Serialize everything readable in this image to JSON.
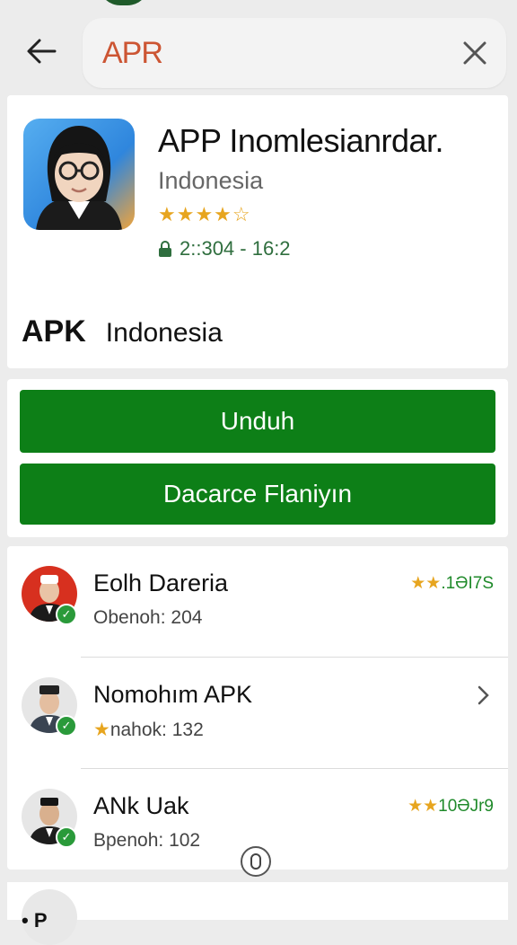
{
  "search": {
    "query": "APR",
    "back_icon": "arrow-left-icon",
    "clear_icon": "close-icon"
  },
  "app": {
    "title": "APP Inomlesianrdar.",
    "subtitle": "Indonesia",
    "rating_stars": "★★★★☆",
    "rating_value": 4.5,
    "meta": "2::304 - 16:2",
    "meta_icon": "lock-icon"
  },
  "brand": {
    "name_part1": "APK",
    "name_part2": "",
    "country": "Indonesia"
  },
  "actions": {
    "primary_label": "Unduh",
    "secondary_label": "Dacarce Flaniyın",
    "button_color": "#0d7f17"
  },
  "list": {
    "items": [
      {
        "name": "Eolh Dareria",
        "sub": "Obenoh: 204",
        "rating_stars": "★★",
        "rating_text": ".1ƏI7S",
        "has_chevron": false
      },
      {
        "name": "Nomohım APK",
        "sub_star": "★",
        "sub": "nahok: 132",
        "has_chevron": true
      },
      {
        "name": "ANk Uak",
        "sub": "Bpenoh: 102",
        "rating_stars": "★★",
        "rating_text": "10ƏJr9",
        "has_chevron": false
      }
    ]
  },
  "bottom_peek": {
    "text": "• P"
  },
  "colors": {
    "accent_green": "#0d7f17",
    "star_gold": "#e7a51f",
    "verified_green": "#2a9a3a"
  }
}
